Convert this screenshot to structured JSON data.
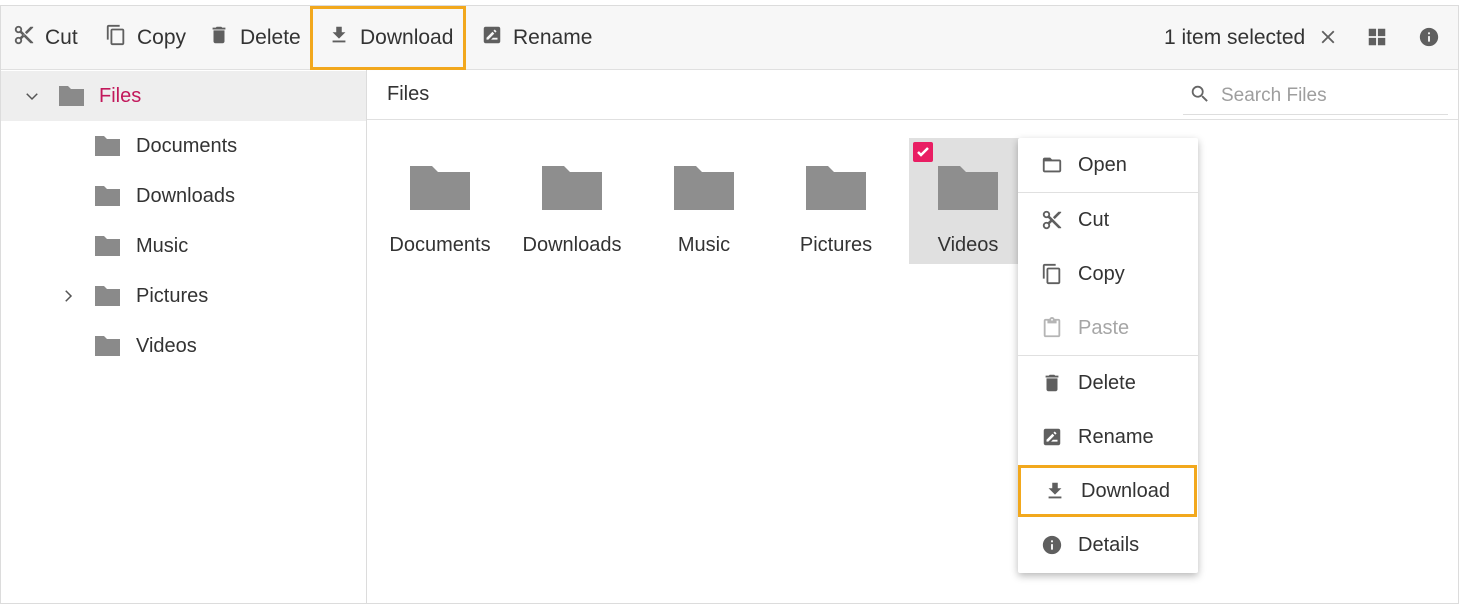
{
  "toolbar": {
    "cut": "Cut",
    "copy": "Copy",
    "delete": "Delete",
    "download": "Download",
    "rename": "Rename",
    "selection_status": "1 item selected",
    "clear_icon": "close-icon",
    "view_icon": "grid-view-icon",
    "details_icon": "info-icon"
  },
  "nav": {
    "root": {
      "label": "Files",
      "expanded": true
    },
    "items": [
      {
        "label": "Documents",
        "expandable": false
      },
      {
        "label": "Downloads",
        "expandable": false
      },
      {
        "label": "Music",
        "expandable": false
      },
      {
        "label": "Pictures",
        "expandable": true
      },
      {
        "label": "Videos",
        "expandable": false
      }
    ]
  },
  "content": {
    "breadcrumb": "Files",
    "search_placeholder": "Search Files",
    "items": [
      {
        "name": "Documents",
        "selected": false
      },
      {
        "name": "Downloads",
        "selected": false
      },
      {
        "name": "Music",
        "selected": false
      },
      {
        "name": "Pictures",
        "selected": false
      },
      {
        "name": "Videos",
        "selected": true
      }
    ]
  },
  "context_menu": {
    "items": [
      {
        "label": "Open",
        "icon": "folder-open-icon",
        "enabled": true
      },
      {
        "label": "Cut",
        "icon": "scissors-icon",
        "enabled": true
      },
      {
        "label": "Copy",
        "icon": "copy-icon",
        "enabled": true
      },
      {
        "label": "Paste",
        "icon": "paste-icon",
        "enabled": false
      },
      {
        "label": "Delete",
        "icon": "trash-icon",
        "enabled": true
      },
      {
        "label": "Rename",
        "icon": "rename-icon",
        "enabled": true
      },
      {
        "label": "Download",
        "icon": "download-icon",
        "enabled": true,
        "highlighted": true
      },
      {
        "label": "Details",
        "icon": "info-icon",
        "enabled": true
      }
    ]
  },
  "colors": {
    "accent": "#e91e63",
    "active_text": "#c2185b",
    "highlight_outline": "#f2a81d",
    "folder": "#8e8e8e"
  }
}
